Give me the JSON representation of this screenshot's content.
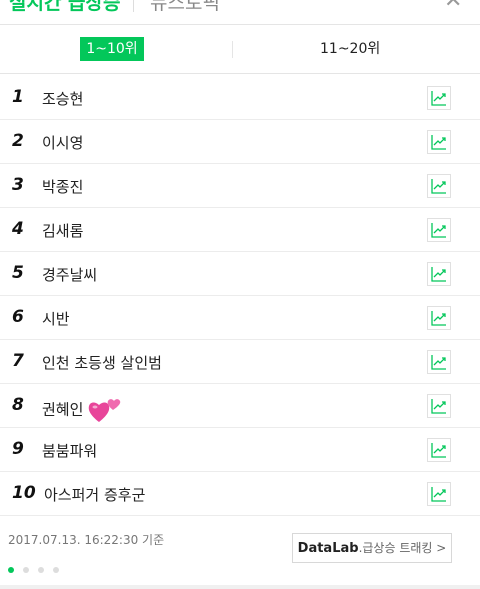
{
  "header": {
    "tab_realtime": "실시간 급상승",
    "tab_news": "뉴스토픽",
    "close_symbol": "✕"
  },
  "range": {
    "first": "1~10위",
    "second": "11~20위"
  },
  "items": [
    {
      "rank": "1",
      "keyword": "조승현"
    },
    {
      "rank": "2",
      "keyword": "이시영"
    },
    {
      "rank": "3",
      "keyword": "박종진"
    },
    {
      "rank": "4",
      "keyword": "김새롬"
    },
    {
      "rank": "5",
      "keyword": "경주날씨"
    },
    {
      "rank": "6",
      "keyword": "시반"
    },
    {
      "rank": "7",
      "keyword": "인천 초등생 살인범"
    },
    {
      "rank": "8",
      "keyword": "권혜인"
    },
    {
      "rank": "9",
      "keyword": "붐붐파워"
    },
    {
      "rank": "10",
      "keyword": "아스퍼거 증후군"
    }
  ],
  "footer": {
    "timestamp": "2017.07.13. 16:22:30 기준",
    "datalab_brand": "DataLab",
    "datalab_text": ".급상승 트래킹 >"
  },
  "colors": {
    "accent": "#03c75a"
  },
  "icons": {
    "trend": "trend-chart-icon",
    "heart": "heart-emoji-icon"
  }
}
